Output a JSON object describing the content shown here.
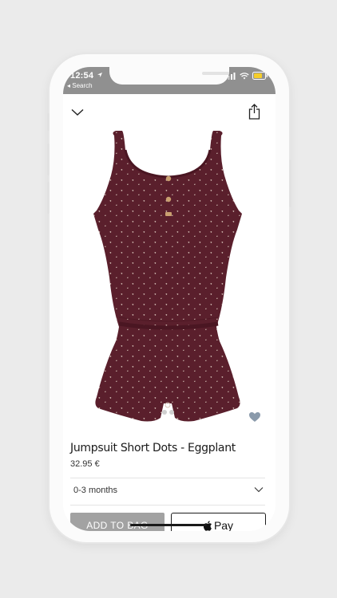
{
  "status": {
    "time": "12:54",
    "back_label": "◂ Search"
  },
  "header": {
    "close_icon": "chevron-down-icon",
    "share_icon": "share-icon"
  },
  "product": {
    "name": "Jumpsuit Short Dots - Eggplant",
    "price": "32.95 €",
    "color_hex": "#5a1f2c",
    "image_dots_active": 1,
    "image_dots_total": 2
  },
  "size": {
    "selected": "0-3 months"
  },
  "actions": {
    "add_to_bag": "ADD TO BAG",
    "apple_pay": "Pay"
  },
  "colors": {
    "status_bar": "#909090",
    "add_button": "#a2a2a2",
    "favorite_icon": "#8a9aab"
  }
}
